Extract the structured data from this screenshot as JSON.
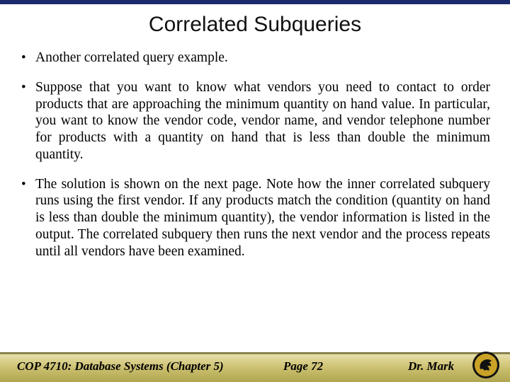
{
  "title": "Correlated Subqueries",
  "bullets": [
    "Another correlated query example.",
    "Suppose that you want to know what vendors you need to contact to order products that are approaching the minimum quantity on hand value.  In particular, you want to know the vendor code, vendor name, and vendor telephone number for products with a quantity on hand that is less than double the minimum quantity.",
    "The solution is shown on the next page.  Note how the inner correlated subquery runs using the first vendor.  If any products match the condition (quantity on hand is less than double the minimum quantity), the vendor information is listed in the output.  The correlated subquery then runs the next vendor and the process repeats until all vendors have been examined."
  ],
  "footer": {
    "left": "COP 4710: Database Systems  (Chapter 5)",
    "center": "Page 72",
    "right": "Dr. Mark"
  }
}
